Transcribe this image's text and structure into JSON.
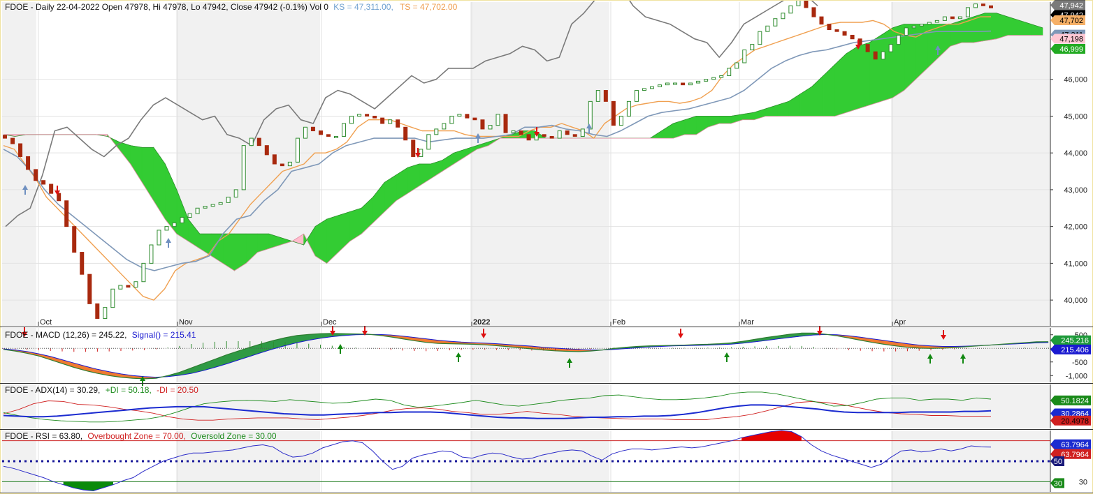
{
  "colors": {
    "bull": "#2e8b2e",
    "bear": "#a8290e",
    "ks": "#f0a050",
    "ts": "#7f98b8",
    "chikou": "#7a7a7a",
    "cloud_bull": "#33cc33",
    "cloud_bear": "#ffbbcc",
    "macd": "#2e9a2e",
    "adx": "#1b2bd0",
    "plus_di": "#1a8a1a",
    "minus_di": "#d02020",
    "rsi": "#2b2bc8",
    "ob": "#e60000",
    "os": "#0a8a0a"
  },
  "header": {
    "price": {
      "main": "FDOE - Daily 22-04-2022 Open 47978, Hi 47978, Lo 47942, Close 47942 (-0.1%) Vol 0",
      "ks": "KS = 47,311.00,",
      "ts": "TS = 47,702.00"
    },
    "macd": {
      "main": "FDOE - MACD (12,26) = 245.22,",
      "signal": "Signal() = 215.41"
    },
    "adx": {
      "main": "FDOE - ADX(14) = 30.29,",
      "pdi": "+DI = 50.18,",
      "mdi": "-DI = 20.50"
    },
    "rsi": {
      "main": "FDOE - RSI = 63.80,",
      "ob": "Overbought Zone = 70.00,",
      "os": "Oversold Zone = 30.00"
    }
  },
  "chart_data": [
    {
      "panel": "price",
      "type": "candlestick",
      "x_labels": [
        "Oct",
        "Nov",
        "Dec",
        "2022",
        "Feb",
        "Mar",
        "Apr"
      ],
      "ylim": [
        39300,
        48100
      ],
      "yticks": [
        40000,
        41000,
        42000,
        43000,
        44000,
        45000,
        46000
      ],
      "closes": [
        44400,
        44250,
        43900,
        43550,
        43250,
        43150,
        42900,
        42700,
        42000,
        41300,
        40700,
        39900,
        39500,
        39800,
        40300,
        40400,
        40350,
        40500,
        41000,
        41500,
        41900,
        42000,
        42100,
        42250,
        42350,
        42500,
        42550,
        42600,
        42650,
        42800,
        43000,
        44200,
        44400,
        44200,
        43950,
        43700,
        43650,
        43750,
        44400,
        44700,
        44600,
        44500,
        44450,
        44450,
        44800,
        45000,
        45050,
        45000,
        44950,
        44800,
        44900,
        44700,
        44350,
        43900,
        44100,
        44500,
        44650,
        44800,
        45000,
        45050,
        44950,
        44900,
        44650,
        44750,
        45050,
        44550,
        44600,
        44500,
        44350,
        44500,
        44450,
        44400,
        44600,
        44500,
        44450,
        44650,
        45400,
        45700,
        45400,
        44750,
        45000,
        45400,
        45700,
        45750,
        45800,
        45850,
        45900,
        45900,
        45850,
        45900,
        45950,
        46000,
        46050,
        46100,
        46300,
        46450,
        46800,
        46950,
        47300,
        47450,
        47650,
        47800,
        48000,
        48150,
        47950,
        47700,
        47500,
        47350,
        47300,
        47200,
        47100,
        46950,
        46750,
        46550,
        46750,
        46950,
        47200,
        47400,
        47450,
        47500,
        47550,
        47600,
        47700,
        47650,
        47700,
        47950,
        48050,
        48000,
        47942
      ],
      "kijun_sen": [
        44200,
        44100,
        43700,
        43300,
        42800,
        42500,
        42200,
        41900,
        41600,
        41300,
        41000,
        40700,
        40400,
        40100,
        40000,
        40300,
        40800,
        41000,
        41100,
        41200,
        41600,
        41800,
        42200,
        42600,
        42900,
        43200,
        43500,
        43600,
        43700,
        44000,
        44000,
        44100,
        44300,
        44700,
        44900,
        44900,
        44900,
        44800,
        44700,
        44600,
        44600,
        44600,
        44600,
        44500,
        44450,
        44450,
        44450,
        44450,
        44450,
        44600,
        44700,
        44700,
        44800,
        44700,
        44600,
        44400,
        44800,
        45000,
        45200,
        45300,
        45350,
        45400,
        45400,
        45350,
        45400,
        45500,
        45700,
        46100,
        46400,
        46600,
        46800,
        46900,
        47000,
        47100,
        47200,
        47300,
        47400,
        47500,
        47550,
        47550,
        47550,
        47600,
        47500,
        47300,
        47200,
        47150,
        47300,
        47400,
        47500,
        47500,
        47600,
        47700,
        47702
      ],
      "tenkan_sen": [
        44100,
        43900,
        43500,
        43000,
        42600,
        42300,
        42000,
        41700,
        41400,
        41100,
        40900,
        40800,
        40900,
        41000,
        41050,
        41200,
        41800,
        42200,
        42300,
        42700,
        43000,
        43500,
        43600,
        43700,
        44000,
        44200,
        44300,
        44400,
        44400,
        44400,
        44400,
        44300,
        44350,
        44400,
        44400,
        44400,
        44450,
        44500,
        44700,
        44700,
        44750,
        44650,
        44600,
        44500,
        44450,
        44600,
        44800,
        45000,
        45100,
        45150,
        45200,
        45300,
        45400,
        45500,
        45700,
        46000,
        46300,
        46500,
        46650,
        46750,
        46800,
        46900,
        47000,
        47050,
        47100,
        47150,
        47200,
        47250,
        47300,
        47300,
        47300,
        47300,
        47311
      ],
      "chikou_span": [
        42000,
        42300,
        42500,
        43400,
        44600,
        44700,
        44400,
        44100,
        43900,
        44200,
        44400,
        44900,
        45300,
        45500,
        45300,
        45100,
        44900,
        45000,
        44500,
        44400,
        44200,
        44900,
        45200,
        45300,
        44900,
        44800,
        45500,
        45700,
        45600,
        45400,
        45200,
        45500,
        45800,
        46100,
        45900,
        46000,
        46300,
        46300,
        46300,
        46500,
        46600,
        46700,
        46900,
        46800,
        46500,
        46600,
        47500,
        47800,
        48200,
        48600,
        48500,
        48000,
        47700,
        47600,
        47500,
        47300,
        47100,
        47000,
        46600,
        47000,
        47500,
        47700,
        47900,
        48100,
        48300,
        48300,
        48000
      ],
      "senkou_a": [
        44500,
        44450,
        44500,
        44500,
        44500,
        44500,
        44500,
        44500,
        44500,
        44450,
        44300,
        44200,
        44150,
        44150,
        43700,
        43000,
        42200,
        41800,
        41800,
        41800,
        41800,
        41800,
        41800,
        41800,
        41700,
        41600,
        41500,
        42000,
        42200,
        42300,
        42400,
        42500,
        42800,
        43200,
        43400,
        43600,
        43700,
        43700,
        43800,
        44000,
        44100,
        44200,
        44300,
        44400,
        44500,
        44600,
        44600,
        44400,
        44400,
        44400,
        44400,
        44400,
        44400,
        44400,
        44400,
        44400,
        44400,
        44600,
        44800,
        44900,
        45000,
        45000,
        45000,
        45000,
        45050,
        45100,
        45200,
        45300,
        45400,
        45600,
        45800,
        46100,
        46400,
        46700,
        46900,
        47000,
        47200,
        47400,
        47500,
        47500,
        47500,
        47500,
        47500,
        47600,
        47700,
        47800,
        47800,
        47700,
        47600,
        47500,
        47400
      ],
      "senkou_b": [
        44500,
        44500,
        44500,
        44500,
        44500,
        44500,
        44500,
        44500,
        44500,
        44500,
        44100,
        43700,
        43200,
        42700,
        42200,
        41800,
        41600,
        41400,
        41200,
        41000,
        40800,
        41000,
        41300,
        41400,
        41500,
        41600,
        41800,
        41200,
        41000,
        41300,
        41600,
        41800,
        42100,
        42400,
        42700,
        42900,
        43100,
        43300,
        43500,
        43700,
        43900,
        44100,
        44200,
        44400,
        44400,
        44400,
        44400,
        44400,
        44400,
        44400,
        44400,
        44400,
        44400,
        44400,
        44400,
        44400,
        44400,
        44400,
        44400,
        44500,
        44500,
        44700,
        44800,
        44800,
        44900,
        44900,
        45000,
        45000,
        45000,
        45000,
        45000,
        45000,
        45000,
        45100,
        45200,
        45300,
        45400,
        45500,
        45700,
        46000,
        46300,
        46600,
        46900,
        47000,
        47000,
        47050,
        47100,
        47200,
        47200,
        47200,
        47200
      ],
      "price_tags": [
        "47,942",
        "47,942",
        "47,942",
        "47,702",
        "47,311",
        "47,198",
        "46,999"
      ]
    },
    {
      "panel": "macd",
      "type": "line",
      "ylim": [
        -1250,
        750
      ],
      "yticks": [
        500,
        0,
        -500,
        -1000
      ],
      "ytick_labels": [
        "500",
        "0",
        "-500",
        "-1,000"
      ],
      "macd": [
        -40,
        -100,
        -180,
        -280,
        -420,
        -560,
        -700,
        -820,
        -920,
        -1000,
        -1060,
        -1100,
        -1120,
        -1100,
        -1000,
        -880,
        -720,
        -560,
        -400,
        -240,
        -100,
        40,
        170,
        290,
        390,
        470,
        510,
        540,
        550,
        540,
        530,
        520,
        480,
        420,
        350,
        280,
        220,
        180,
        170,
        160,
        150,
        130,
        100,
        60,
        20,
        -20,
        -60,
        -90,
        -110,
        -120,
        -100,
        -60,
        0,
        40,
        70,
        90,
        100,
        110,
        120,
        140,
        150,
        170,
        200,
        260,
        330,
        400,
        460,
        520,
        560,
        560,
        520,
        460,
        380,
        300,
        220,
        150,
        90,
        40,
        10,
        0,
        10,
        30,
        60,
        90,
        120,
        150,
        180,
        210,
        240,
        245
      ],
      "signal": [
        -20,
        -60,
        -120,
        -200,
        -300,
        -420,
        -540,
        -660,
        -770,
        -860,
        -940,
        -1000,
        -1040,
        -1060,
        -1040,
        -990,
        -920,
        -820,
        -700,
        -570,
        -430,
        -290,
        -150,
        -20,
        100,
        210,
        300,
        370,
        430,
        470,
        500,
        510,
        510,
        490,
        450,
        400,
        350,
        300,
        260,
        230,
        210,
        190,
        170,
        140,
        110,
        80,
        40,
        10,
        -20,
        -40,
        -60,
        -60,
        -40,
        -10,
        20,
        50,
        70,
        90,
        100,
        110,
        120,
        135,
        155,
        190,
        240,
        290,
        350,
        400,
        450,
        490,
        510,
        500,
        460,
        410,
        350,
        290,
        230,
        170,
        120,
        90,
        70,
        70,
        80,
        100,
        120,
        140,
        160,
        180,
        200,
        215
      ],
      "tags": [
        "245.216",
        "215.406"
      ]
    },
    {
      "panel": "adx",
      "type": "line",
      "ylim": [
        0,
        75
      ],
      "adx": [
        22,
        21,
        20,
        20,
        21,
        23,
        25,
        27,
        29,
        31,
        33,
        35,
        36,
        37,
        37,
        37,
        35,
        33,
        31,
        29,
        27,
        25,
        24,
        23,
        23,
        24,
        25,
        26,
        27,
        27,
        28,
        28,
        28,
        27,
        25,
        23,
        21,
        19,
        18,
        18,
        17,
        17,
        17,
        18,
        19,
        19,
        20,
        20,
        21,
        21,
        22,
        24,
        27,
        31,
        35,
        38,
        40,
        40,
        39,
        37,
        35,
        33,
        30,
        28,
        27,
        27,
        27,
        27,
        28,
        28,
        28,
        28,
        29,
        29,
        30
      ],
      "plus_di": [
        27,
        22,
        18,
        15,
        13,
        12,
        11,
        11,
        12,
        14,
        16,
        20,
        27,
        35,
        42,
        45,
        47,
        48,
        47,
        46,
        49,
        47,
        45,
        43,
        44,
        47,
        50,
        48,
        40,
        36,
        38,
        41,
        44,
        48,
        44,
        40,
        38,
        41,
        44,
        48,
        50,
        52,
        56,
        57,
        54,
        51,
        49,
        49,
        50,
        52,
        55,
        60,
        62,
        62,
        59,
        54,
        49,
        44,
        38,
        39,
        44,
        50,
        52,
        52,
        48,
        50,
        50,
        48,
        52,
        50
      ],
      "minus_di": [
        25,
        32,
        42,
        47,
        46,
        41,
        40,
        37,
        33,
        30,
        26,
        20,
        16,
        14,
        14,
        16,
        17,
        18,
        18,
        18,
        16,
        15,
        17,
        19,
        22,
        26,
        31,
        34,
        35,
        33,
        29,
        27,
        24,
        24,
        26,
        29,
        26,
        24,
        21,
        19,
        18,
        17,
        16,
        16,
        16,
        15,
        15,
        15,
        18,
        20,
        24,
        30,
        37,
        44,
        46,
        44,
        41,
        36,
        31,
        27,
        25,
        24,
        22,
        22,
        21,
        21,
        20.5
      ]
    },
    {
      "panel": "rsi",
      "type": "line",
      "ylim": [
        20,
        80
      ],
      "rsi": [
        45,
        43,
        40,
        37,
        34,
        30,
        27,
        24,
        22,
        21,
        24,
        27,
        31,
        34,
        40,
        45,
        50,
        53,
        56,
        58,
        58,
        59,
        60,
        61,
        63,
        65,
        66,
        64,
        58,
        54,
        55,
        58,
        63,
        66,
        69,
        70,
        68,
        60,
        50,
        42,
        45,
        53,
        56,
        58,
        60,
        59,
        54,
        53,
        56,
        58,
        57,
        54,
        52,
        53,
        56,
        58,
        60,
        61,
        60,
        55,
        51,
        57,
        60,
        62,
        62,
        61,
        62,
        63,
        64,
        63,
        64,
        66,
        68,
        70,
        73,
        75,
        77,
        79,
        80,
        79,
        74,
        66,
        60,
        56,
        53,
        50,
        47,
        44,
        47,
        54,
        60,
        61,
        59,
        60,
        62,
        60,
        62,
        65,
        64,
        63.8
      ],
      "tags": [
        "70",
        "63.7964",
        "63.7964",
        "50",
        "30"
      ],
      "axis_label": "30"
    }
  ]
}
